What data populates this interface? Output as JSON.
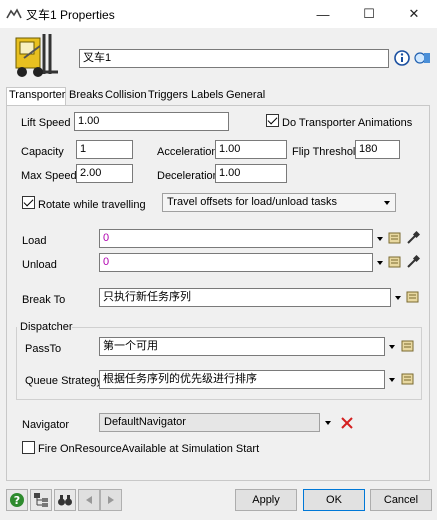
{
  "window": {
    "title": "叉车1  Properties",
    "minimize": "—",
    "maximize": "☐",
    "close": "✕"
  },
  "object_name": "叉车1",
  "tabs": [
    {
      "label": "Transporter"
    },
    {
      "label": "Breaks"
    },
    {
      "label": "Collision"
    },
    {
      "label": "Triggers"
    },
    {
      "label": "Labels"
    },
    {
      "label": "General"
    }
  ],
  "fields": {
    "lift_speed": {
      "label": "Lift Speed",
      "value": "1.00"
    },
    "do_animations": {
      "label": "Do Transporter Animations",
      "checked": true
    },
    "capacity": {
      "label": "Capacity",
      "value": "1"
    },
    "acceleration": {
      "label": "Acceleration",
      "value": "1.00"
    },
    "flip_threshold": {
      "label": "Flip Threshold",
      "value": "180"
    },
    "max_speed": {
      "label": "Max Speed",
      "value": "2.00"
    },
    "deceleration": {
      "label": "Deceleration",
      "value": "1.00"
    },
    "rotate": {
      "label": "Rotate while travelling",
      "checked": true
    },
    "travel_offsets": {
      "value": "Travel offsets for load/unload tasks"
    },
    "load": {
      "label": "Load",
      "value": "0"
    },
    "unload": {
      "label": "Unload",
      "value": "0"
    },
    "break_to": {
      "label": "Break To",
      "value": "只执行新任务序列"
    },
    "dispatcher": {
      "label": "Dispatcher"
    },
    "pass_to": {
      "label": "PassTo",
      "value": "第一个可用"
    },
    "queue_strategy": {
      "label": "Queue Strategy",
      "value": "根据任务序列的优先级进行排序"
    },
    "navigator": {
      "label": "Navigator",
      "value": "DefaultNavigator"
    },
    "fire_resource": {
      "label": "Fire OnResourceAvailable at Simulation Start",
      "checked": false
    }
  },
  "buttons": {
    "apply": "Apply",
    "ok": "OK",
    "cancel": "Cancel"
  },
  "colors": {
    "code_text": "#b000b0",
    "delete_red": "#d42020",
    "help_green": "#2e8b2e",
    "info_blue": "#1a4fa0"
  }
}
